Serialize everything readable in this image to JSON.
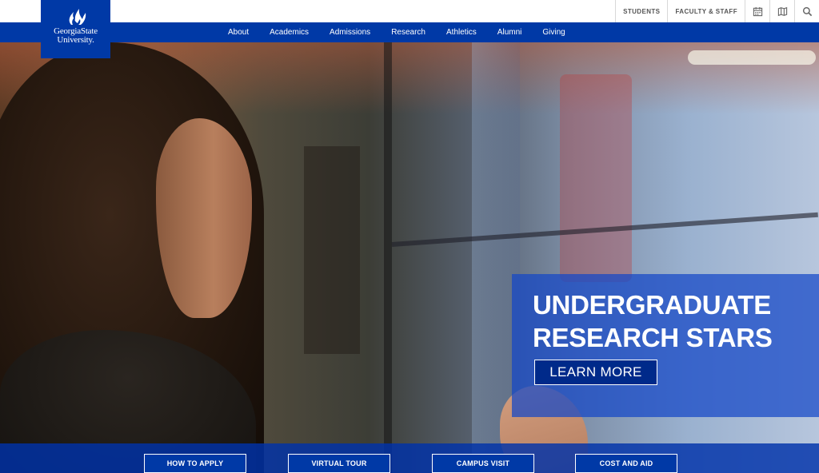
{
  "utility": {
    "links": [
      "STUDENTS",
      "FACULTY & STAFF"
    ],
    "icons": [
      "calendar-icon",
      "map-icon",
      "search-icon"
    ]
  },
  "logo": {
    "line1": "GeorgiaState",
    "line2": "University."
  },
  "nav": {
    "items": [
      "About",
      "Academics",
      "Admissions",
      "Research",
      "Athletics",
      "Alumni",
      "Giving"
    ]
  },
  "hero": {
    "title_line1": "UNDERGRADUATE",
    "title_line2": "RESEARCH STARS",
    "cta_label": "LEARN MORE"
  },
  "cta_bar": {
    "buttons": [
      "HOW TO APPLY",
      "VIRTUAL TOUR",
      "CAMPUS VISIT",
      "COST AND AID"
    ]
  },
  "colors": {
    "brand_blue": "#0039a6",
    "white": "#ffffff"
  }
}
